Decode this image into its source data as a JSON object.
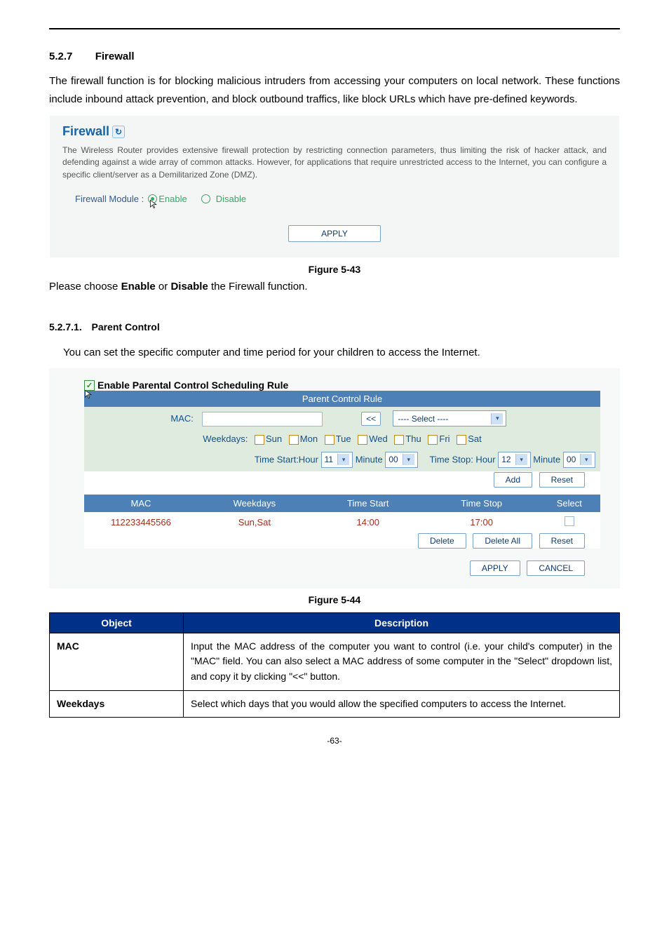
{
  "section_number": "5.2.7",
  "section_title": "Firewall",
  "intro_text": "The firewall function is for blocking malicious intruders from accessing your computers on local network. These functions include inbound attack prevention, and block outbound traffics, like block URLs which have pre-defined keywords.",
  "firewall_panel": {
    "heading": "Firewall",
    "description": "The Wireless Router provides extensive firewall protection by restricting connection parameters, thus limiting the risk of hacker attack, and defending against a wide array of common attacks. However, for applications that require unrestricted access to the Internet, you can configure a specific client/server as a Demilitarized Zone (DMZ).",
    "module_label": "Firewall Module :",
    "enable_label": "Enable",
    "disable_label": "Disable",
    "apply_label": "APPLY"
  },
  "figure_43": "Figure 5-43",
  "choose_line_prefix": "Please choose ",
  "choose_enable": "Enable",
  "choose_mid": " or ",
  "choose_disable": "Disable",
  "choose_suffix": " the Firewall function.",
  "subsection_number": "5.2.7.1.",
  "subsection_title": "Parent Control",
  "pc_intro": "You can set the specific computer and time period for your children to access the Internet.",
  "pc_panel": {
    "enable_label": "Enable Parental Control Scheduling Rule",
    "rule_title": "Parent Control Rule",
    "mac_label": "MAC:",
    "copy_btn": "<<",
    "select_placeholder": "---- Select ----",
    "weekdays_label": "Weekdays:",
    "days": [
      "Sun",
      "Mon",
      "Tue",
      "Wed",
      "Thu",
      "Fri",
      "Sat"
    ],
    "time_start_label": "Time Start:Hour",
    "minute_label": "Minute",
    "time_stop_label": "Time Stop: Hour",
    "hour_start": "11",
    "min_start": "00",
    "hour_stop": "12",
    "min_stop": "00",
    "add_btn": "Add",
    "reset_btn": "Reset",
    "headers": {
      "mac": "MAC",
      "wk": "Weekdays",
      "ts": "Time Start",
      "tstop": "Time Stop",
      "sel": "Select"
    },
    "row": {
      "mac": "112233445566",
      "wk": "Sun,Sat",
      "ts": "14:00",
      "tstop": "17:00"
    },
    "delete_btn": "Delete",
    "delete_all_btn": "Delete All",
    "reset2_btn": "Reset",
    "apply_btn": "APPLY",
    "cancel_btn": "CANCEL"
  },
  "figure_44": "Figure 5-44",
  "desc_table": {
    "h_obj": "Object",
    "h_desc": "Description",
    "rows": [
      {
        "obj": "MAC",
        "desc": "Input the MAC address of the computer you want to control (i.e. your child's computer) in the \"MAC\" field. You can also select a MAC address of some computer in the \"Select\" dropdown list, and copy it by clicking \"<<\" button."
      },
      {
        "obj": "Weekdays",
        "desc": "Select which days that you would allow the specified computers to access the Internet."
      }
    ]
  },
  "page_number": "-63-"
}
